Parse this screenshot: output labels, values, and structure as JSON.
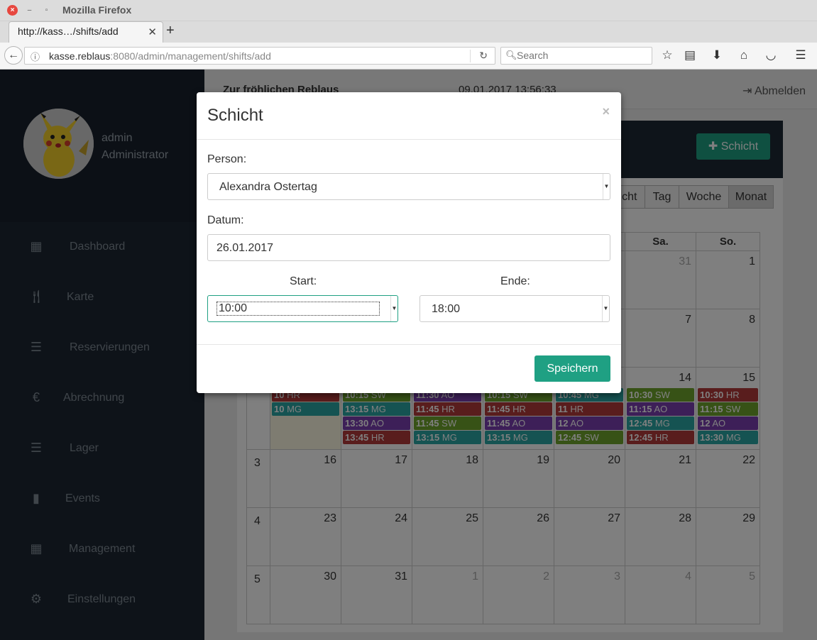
{
  "browser": {
    "window_title": "Mozilla Firefox",
    "tab_title": "http://kass…/shifts/add",
    "url_host": "kasse.reblaus",
    "url_rest": ":8080/admin/management/shifts/add",
    "search_placeholder": "Search"
  },
  "header": {
    "brand": "Zur fröhlichen Reblaus",
    "datetime": "09.01.2017 13:56:33",
    "logout": "Abmelden"
  },
  "user": {
    "name": "admin",
    "role": "Administrator"
  },
  "sidebar": {
    "items": [
      {
        "label": "Dashboard",
        "icon": "grid-icon"
      },
      {
        "label": "Karte",
        "icon": "cutlery-icon"
      },
      {
        "label": "Reservierungen",
        "icon": "list-icon"
      },
      {
        "label": "Abrechnung",
        "icon": "euro-icon"
      },
      {
        "label": "Lager",
        "icon": "list-icon"
      },
      {
        "label": "Events",
        "icon": "bookmark-icon"
      },
      {
        "label": "Management",
        "icon": "calendar-icon"
      },
      {
        "label": "Einstellungen",
        "icon": "gear-icon"
      }
    ]
  },
  "calendar": {
    "add_button": "Schicht",
    "views": [
      "icht",
      "Tag",
      "Woche",
      "Monat"
    ],
    "active_view": "Monat",
    "weekdays": [
      "Sa.",
      "So."
    ],
    "rows": [
      {
        "week": "",
        "days": [
          "",
          "",
          "",
          "",
          "",
          "31",
          "1"
        ]
      },
      {
        "week": "",
        "days": [
          "",
          "",
          "",
          "",
          "",
          "7",
          "8"
        ]
      },
      {
        "week": "",
        "days": [
          "",
          "",
          "",
          "",
          "",
          "14",
          "15"
        ]
      },
      {
        "week": "3",
        "days": [
          "16",
          "17",
          "18",
          "19",
          "20",
          "21",
          "22"
        ]
      },
      {
        "week": "4",
        "days": [
          "23",
          "24",
          "25",
          "26",
          "27",
          "28",
          "29"
        ]
      },
      {
        "week": "5",
        "days": [
          "30",
          "31",
          "1",
          "2",
          "3",
          "4",
          "5"
        ]
      }
    ],
    "events": [
      [
        {
          "t": "10",
          "p": "HR",
          "c": "red"
        },
        {
          "t": "10",
          "p": "MG",
          "c": "teal"
        }
      ],
      [
        {
          "t": "10:15",
          "p": "SW",
          "c": "green"
        },
        {
          "t": "13:15",
          "p": "MG",
          "c": "teal"
        },
        {
          "t": "13:30",
          "p": "AO",
          "c": "purple"
        },
        {
          "t": "13:45",
          "p": "HR",
          "c": "red"
        }
      ],
      [
        {
          "t": "11:30",
          "p": "AO",
          "c": "purple"
        },
        {
          "t": "11:45",
          "p": "HR",
          "c": "red"
        },
        {
          "t": "11:45",
          "p": "SW",
          "c": "green"
        },
        {
          "t": "13:15",
          "p": "MG",
          "c": "teal"
        }
      ],
      [
        {
          "t": "10:15",
          "p": "SW",
          "c": "green"
        },
        {
          "t": "11:45",
          "p": "HR",
          "c": "red"
        },
        {
          "t": "11:45",
          "p": "AO",
          "c": "purple"
        },
        {
          "t": "13:15",
          "p": "MG",
          "c": "teal"
        }
      ],
      [
        {
          "t": "10:45",
          "p": "MG",
          "c": "teal"
        },
        {
          "t": "11",
          "p": "HR",
          "c": "red"
        },
        {
          "t": "12",
          "p": "AO",
          "c": "purple"
        },
        {
          "t": "12:45",
          "p": "SW",
          "c": "green"
        }
      ],
      [
        {
          "t": "10:30",
          "p": "SW",
          "c": "green"
        },
        {
          "t": "11:15",
          "p": "AO",
          "c": "purple"
        },
        {
          "t": "12:45",
          "p": "MG",
          "c": "teal"
        },
        {
          "t": "12:45",
          "p": "HR",
          "c": "red"
        }
      ],
      [
        {
          "t": "10:30",
          "p": "HR",
          "c": "red"
        },
        {
          "t": "11:15",
          "p": "SW",
          "c": "green"
        },
        {
          "t": "12",
          "p": "AO",
          "c": "purple"
        },
        {
          "t": "13:30",
          "p": "MG",
          "c": "teal"
        }
      ]
    ],
    "colors": {
      "red": "#b33a3a",
      "teal": "#2aa7a5",
      "purple": "#7b3fb0",
      "green": "#6fa52d"
    }
  },
  "modal": {
    "title": "Schicht",
    "close": "×",
    "person_label": "Person:",
    "person_value": "Alexandra Ostertag",
    "date_label": "Datum:",
    "date_value": "26.01.2017",
    "start_label": "Start:",
    "start_value": "10:00",
    "end_label": "Ende:",
    "end_value": "18:00",
    "save": "Speichern"
  }
}
